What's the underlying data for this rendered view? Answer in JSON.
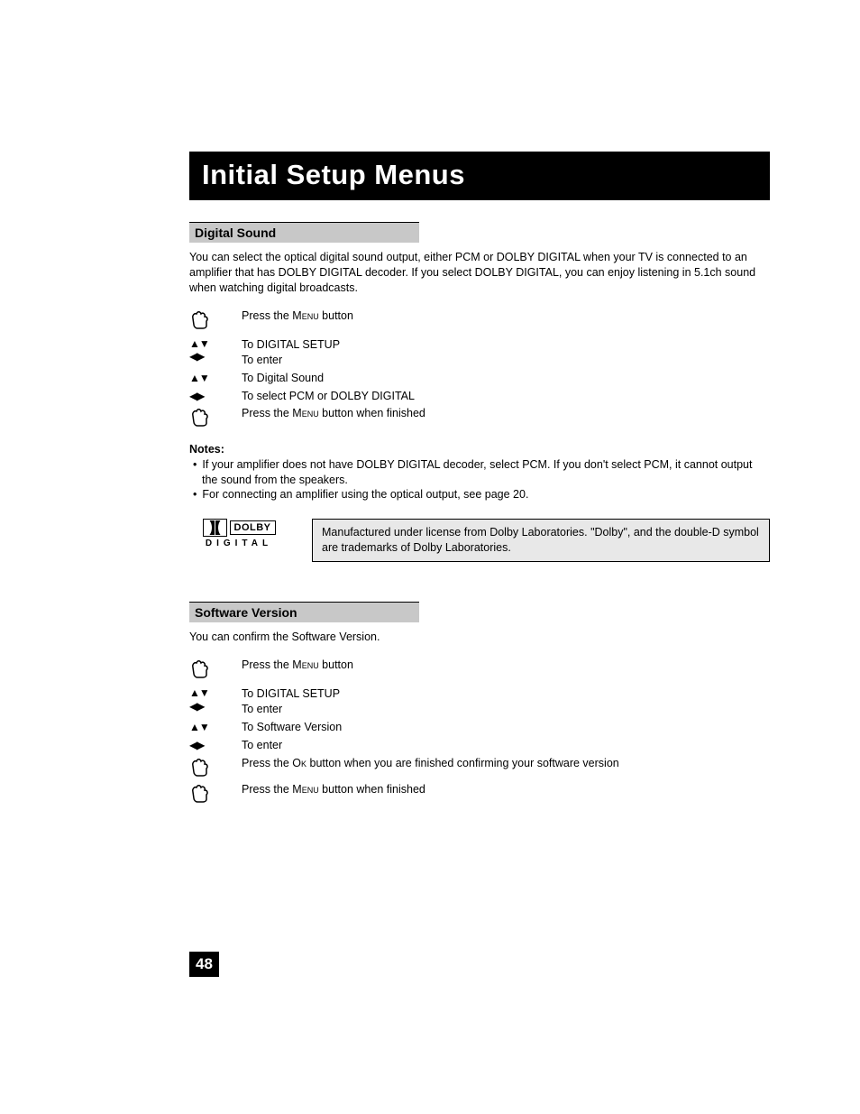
{
  "title": "Initial Setup Menus",
  "sections": {
    "digital_sound": {
      "heading": "Digital Sound",
      "intro": "You can select the optical digital sound output, either PCM or DOLBY DIGITAL when your TV is connected to an amplifier that has DOLBY DIGITAL decoder.  If you select DOLBY DIGITAL, you can enjoy listening in 5.1ch sound when watching digital broadcasts.",
      "steps": [
        {
          "icon": "hand",
          "text_pre": "Press the M",
          "text_sc": "enu",
          "text_post": " button"
        },
        {
          "icon": "updown",
          "text": "To DIGITAL SETUP"
        },
        {
          "icon": "leftright",
          "text": "To enter"
        },
        {
          "icon": "updown",
          "text": "To Digital Sound"
        },
        {
          "icon": "leftright",
          "text": "To select PCM or DOLBY DIGITAL"
        },
        {
          "icon": "hand",
          "text_pre": "Press the M",
          "text_sc": "enu",
          "text_post": " button when finished"
        }
      ],
      "notes_label": "Notes:",
      "notes": [
        "If your amplifier does not have DOLBY DIGITAL decoder, select PCM.  If you don't select PCM, it cannot output the sound from the speakers.",
        "For connecting an amplifier using the optical output, see page 20."
      ],
      "dolby_logo": {
        "brand": "DOLBY",
        "sub": "DIGITAL"
      },
      "license": "Manufactured under license from Dolby Laboratories.  \"Dolby\", and the double-D symbol are trademarks of Dolby Laboratories."
    },
    "software_version": {
      "heading": "Software Version",
      "intro": "You can confirm the Software Version.",
      "steps": [
        {
          "icon": "hand",
          "text_pre": "Press the M",
          "text_sc": "enu",
          "text_post": " button"
        },
        {
          "icon": "updown",
          "text": "To DIGITAL SETUP"
        },
        {
          "icon": "leftright",
          "text": "To enter"
        },
        {
          "icon": "updown",
          "text": "To Software Version"
        },
        {
          "icon": "leftright",
          "text": "To enter"
        },
        {
          "icon": "hand",
          "text_pre": "Press the O",
          "text_sc": "k",
          "text_post": " button when you are finished confirming your software version"
        },
        {
          "icon": "hand",
          "text_pre": "Press the M",
          "text_sc": "enu",
          "text_post": " button when finished"
        }
      ]
    }
  },
  "page_number": "48"
}
